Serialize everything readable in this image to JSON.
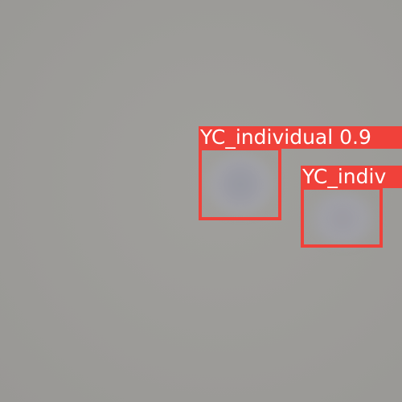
{
  "detections": [
    {
      "label": "YC_individual 0.9",
      "color": "#f0413a"
    },
    {
      "label": "YC_indiv",
      "color": "#f0413a"
    }
  ],
  "background_color": "#9d9c99"
}
